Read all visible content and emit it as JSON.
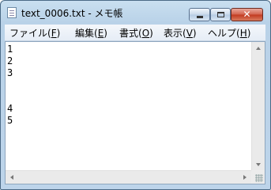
{
  "window": {
    "title": "text_0006.txt - メモ帳"
  },
  "controls": {
    "close_glyph": "✕"
  },
  "menu": [
    {
      "label": "ファイル",
      "mnemonic_open": "(",
      "mnemonic": "F",
      "mnemonic_close": ")"
    },
    {
      "label": "編集",
      "mnemonic_open": "(",
      "mnemonic": "E",
      "mnemonic_close": ")"
    },
    {
      "label": "書式",
      "mnemonic_open": "(",
      "mnemonic": "O",
      "mnemonic_close": ")"
    },
    {
      "label": "表示",
      "mnemonic_open": "(",
      "mnemonic": "V",
      "mnemonic_close": ")"
    },
    {
      "label": "ヘルプ",
      "mnemonic_open": "(",
      "mnemonic": "H",
      "mnemonic_close": ")"
    }
  ],
  "document": {
    "lines": [
      "1",
      "2",
      "3",
      "",
      "",
      "4",
      "5"
    ]
  }
}
